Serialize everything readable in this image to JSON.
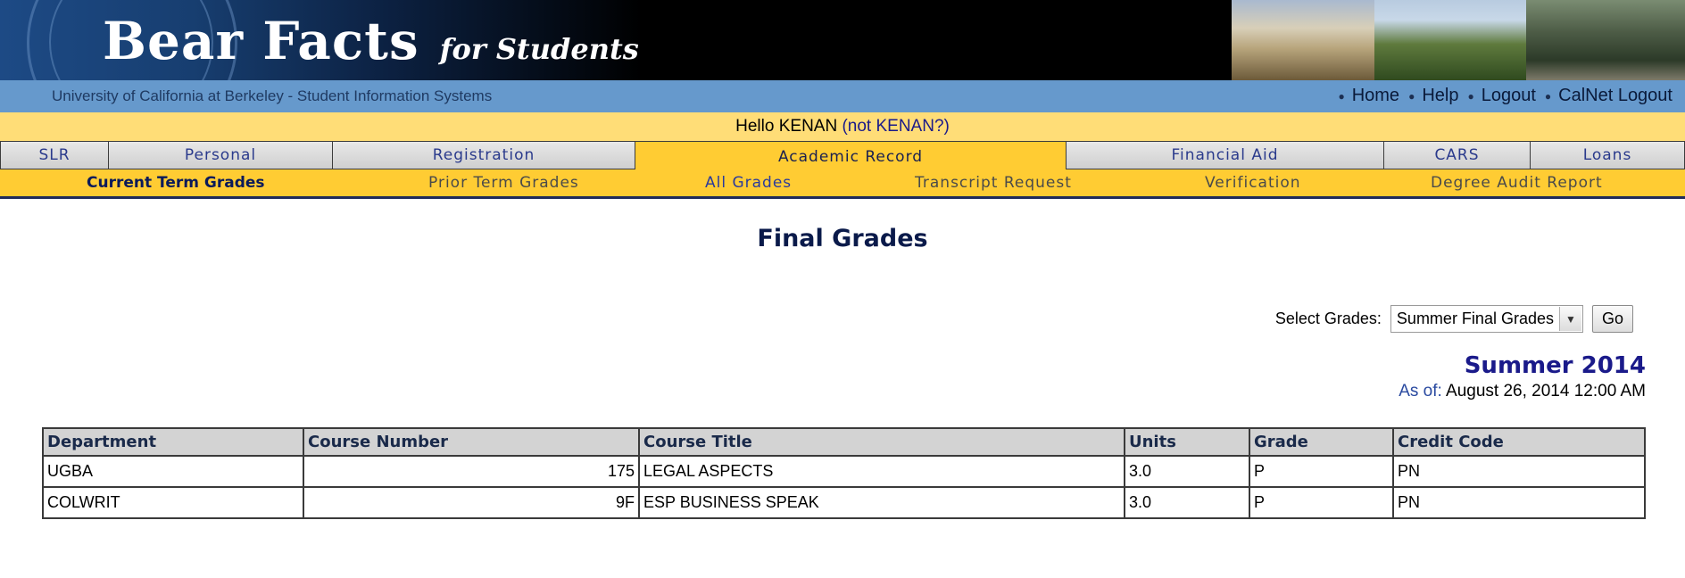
{
  "banner": {
    "title": "Bear Facts",
    "subtitle": "for Students"
  },
  "infobar": {
    "university": "University of California at Berkeley  -  Student Information Systems",
    "links": [
      "Home",
      "Help",
      "Logout",
      "CalNet Logout"
    ]
  },
  "greeting": {
    "hello": "Hello KENAN",
    "not_link": "(not KENAN?)"
  },
  "tabs": {
    "items": [
      "SLR",
      "Personal",
      "Registration",
      "Academic Record",
      "Financial Aid",
      "CARS",
      "Loans"
    ],
    "active": "Academic Record"
  },
  "subtabs": {
    "items": [
      "Current Term Grades",
      "Prior Term Grades",
      "All Grades",
      "Transcript Request",
      "Verification",
      "Degree Audit Report"
    ],
    "current": "Current Term Grades"
  },
  "main": {
    "title": "Final Grades",
    "select_label": "Select Grades:",
    "select_value": "Summer Final Grades",
    "go_label": "Go",
    "term": "Summer 2014",
    "as_of_label": "As of:",
    "as_of_value": "August 26, 2014 12:00 AM"
  },
  "table": {
    "headers": [
      "Department",
      "Course Number",
      "Course Title",
      "Units",
      "Grade",
      "Credit Code"
    ],
    "rows": [
      [
        "UGBA",
        "175",
        "LEGAL ASPECTS",
        "3.0",
        "P",
        "PN"
      ],
      [
        "COLWRIT",
        "9F",
        "ESP BUSINESS SPEAK",
        "3.0",
        "P",
        "PN"
      ]
    ]
  },
  "icons": {
    "bullet": "bullet-icon",
    "dropdown": "chevron-down-icon",
    "banner_seal": "university-seal-icon"
  },
  "colors": {
    "info_bar": "#6699cc",
    "greeting_bar": "#ffdd77",
    "active_tab": "#ffcc33",
    "link": "#1a1a8a",
    "header_fill": "#d3d3d3"
  }
}
